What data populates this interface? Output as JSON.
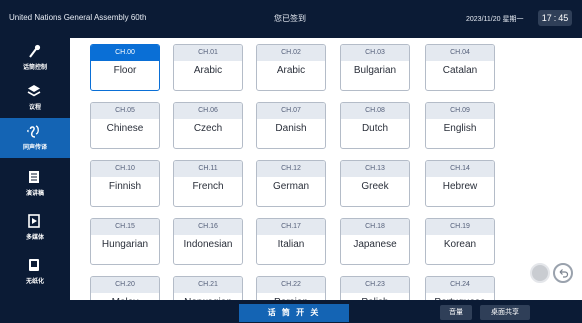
{
  "header": {
    "title": "United Nations General Assembly 60th",
    "status": "您已签到",
    "date": "2023/11/20 星期一",
    "time_hour": "17",
    "time_minute": "45"
  },
  "sidebar": {
    "items": [
      {
        "label": "话筒控制",
        "icon": "microphone-icon"
      },
      {
        "label": "议程",
        "icon": "agenda-icon"
      },
      {
        "label": "同声传译",
        "icon": "interpretation-icon",
        "active": true
      },
      {
        "label": "演讲稿",
        "icon": "document-icon"
      },
      {
        "label": "多媒体",
        "icon": "media-icon"
      },
      {
        "label": "无纸化",
        "icon": "tablet-icon"
      }
    ]
  },
  "channels": [
    {
      "ch": "CH.00",
      "name": "Floor",
      "selected": true
    },
    {
      "ch": "CH.01",
      "name": "Arabic"
    },
    {
      "ch": "CH.02",
      "name": "Arabic"
    },
    {
      "ch": "CH.03",
      "name": "Bulgarian"
    },
    {
      "ch": "CH.04",
      "name": "Catalan"
    },
    {
      "ch": "CH.05",
      "name": "Chinese"
    },
    {
      "ch": "CH.06",
      "name": "Czech"
    },
    {
      "ch": "CH.07",
      "name": "Danish"
    },
    {
      "ch": "CH.08",
      "name": "Dutch"
    },
    {
      "ch": "CH.09",
      "name": "English"
    },
    {
      "ch": "CH.10",
      "name": "Finnish"
    },
    {
      "ch": "CH.11",
      "name": "French"
    },
    {
      "ch": "CH.12",
      "name": "German"
    },
    {
      "ch": "CH.13",
      "name": "Greek"
    },
    {
      "ch": "CH.14",
      "name": "Hebrew"
    },
    {
      "ch": "CH.15",
      "name": "Hungarian"
    },
    {
      "ch": "CH.16",
      "name": "Indonesian"
    },
    {
      "ch": "CH.17",
      "name": "Italian"
    },
    {
      "ch": "CH.18",
      "name": "Japanese"
    },
    {
      "ch": "CH.19",
      "name": "Korean"
    },
    {
      "ch": "CH.20",
      "name": "Malay"
    },
    {
      "ch": "CH.21",
      "name": "Norwegian"
    },
    {
      "ch": "CH.22",
      "name": "Persian"
    },
    {
      "ch": "CH.23",
      "name": "Polish"
    },
    {
      "ch": "CH.24",
      "name": "Portuguese"
    }
  ],
  "footer": {
    "speak_label": "话 筒 开 关",
    "volume_label": "音量",
    "share_label": "桌面共享"
  },
  "colors": {
    "accent": "#1464b4",
    "selected": "#0a6fd6",
    "bar_bg": "#0b1b35"
  }
}
